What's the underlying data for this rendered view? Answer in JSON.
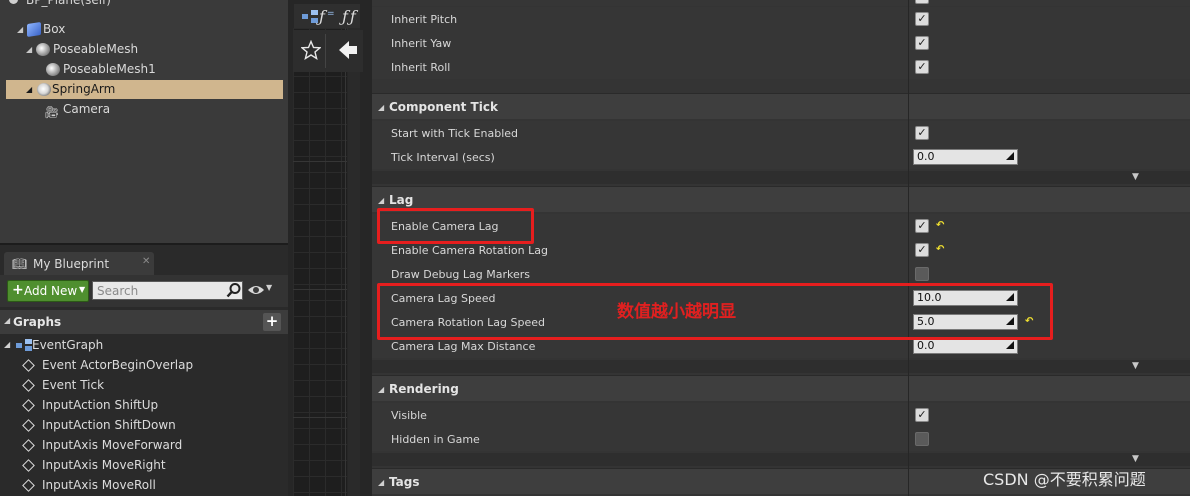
{
  "component_tree": {
    "root_label": "BP_Plane(self)",
    "items": [
      {
        "label": "Box"
      },
      {
        "label": "PoseableMesh"
      },
      {
        "label": "PoseableMesh1"
      },
      {
        "label": "SpringArm"
      },
      {
        "label": "Camera"
      }
    ]
  },
  "my_blueprint": {
    "tab_label": "My Blueprint",
    "add_new_label": "Add New",
    "search_placeholder": "Search",
    "graphs_header": "Graphs",
    "event_graph_label": "EventGraph",
    "events": [
      "Event ActorBeginOverlap",
      "Event Tick",
      "InputAction ShiftUp",
      "InputAction ShiftDown",
      "InputAxis MoveForward",
      "InputAxis MoveRight",
      "InputAxis MoveRoll"
    ]
  },
  "details": {
    "inherit_rows": [
      {
        "label": "Inherit Pitch",
        "checked": true
      },
      {
        "label": "Inherit Yaw",
        "checked": true
      },
      {
        "label": "Inherit Roll",
        "checked": true
      }
    ],
    "component_tick": {
      "title": "Component Tick",
      "start_with_tick_enabled": {
        "label": "Start with Tick Enabled",
        "checked": true
      },
      "tick_interval": {
        "label": "Tick Interval (secs)",
        "value": "0.0"
      }
    },
    "lag": {
      "title": "Lag",
      "enable_camera_lag": {
        "label": "Enable Camera Lag",
        "checked": true
      },
      "enable_camera_rotation_lag": {
        "label": "Enable Camera Rotation Lag",
        "checked": true
      },
      "draw_debug_lag_markers": {
        "label": "Draw Debug Lag Markers",
        "checked": false
      },
      "camera_lag_speed": {
        "label": "Camera Lag Speed",
        "value": "10.0"
      },
      "camera_rotation_lag_speed": {
        "label": "Camera Rotation Lag Speed",
        "value": "5.0"
      },
      "camera_lag_max_distance": {
        "label": "Camera Lag Max Distance",
        "value": "0.0"
      }
    },
    "rendering": {
      "title": "Rendering",
      "visible": {
        "label": "Visible",
        "checked": true
      },
      "hidden_in_game": {
        "label": "Hidden in Game",
        "checked": false
      }
    },
    "tags_title": "Tags"
  },
  "annotation_note": "数值越小越明显",
  "watermark": "CSDN @不要积累问题",
  "colors": {
    "selection": "#d0b68e",
    "add_new_green": "#4f8f2f",
    "annotation_red": "#e61e1e",
    "reset_arrow_yellow": "#f0e030"
  },
  "icons": [
    "component-icon",
    "box-icon",
    "mesh-icon",
    "spring-arm-icon",
    "camera-icon",
    "blueprint-book-icon",
    "close-icon",
    "plus-icon",
    "search-icon",
    "eye-icon",
    "graph-icon",
    "event-diamond-icon",
    "star-icon",
    "back-arrow-icon",
    "reset-to-default-icon",
    "checkmark-icon",
    "expand-chevron-icon"
  ]
}
